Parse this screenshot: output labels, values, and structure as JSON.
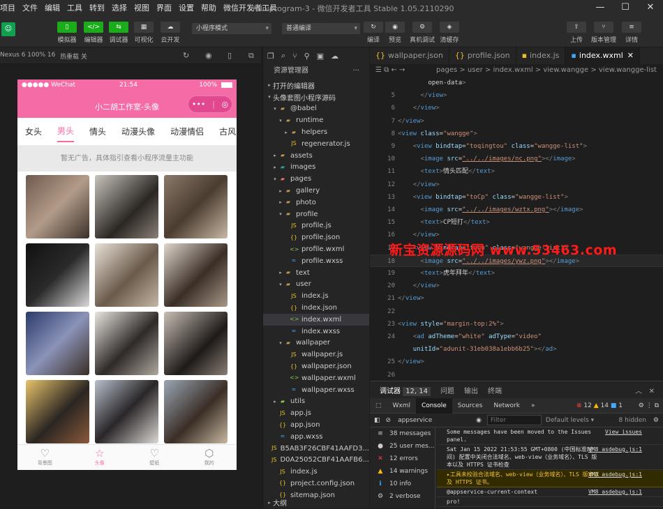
{
  "menu": [
    "项目",
    "文件",
    "编辑",
    "工具",
    "转到",
    "选择",
    "视图",
    "界面",
    "设置",
    "帮助",
    "微信开发者工具"
  ],
  "window_title": "miniprogram-3 - 微信开发者工具 Stable 1.05.2110290",
  "toolbar": {
    "left": [
      "模拟器",
      "编辑器",
      "调试器",
      "可视化",
      "云开发"
    ],
    "mode_select": "小程序模式",
    "compile_select": "普通编译",
    "mid": [
      "编译",
      "预览",
      "真机调试",
      "清缓存"
    ],
    "right": [
      "上传",
      "版本管理",
      "详情"
    ]
  },
  "sim_bar": {
    "device": "Nexus 6 100% 16",
    "hot_reload": "热重载 关"
  },
  "phone": {
    "carrier": "●●●●● WeChat",
    "time": "21:54",
    "battery": "100%",
    "nav_title": "小二胡工作室-头像",
    "capsule_more": "•••",
    "capsule_close": "◎",
    "tabs": [
      "女头",
      "男头",
      "情头",
      "动漫头像",
      "动漫情侣",
      "古风"
    ],
    "ad_text": "暂无广告，具体指引查看小程序流量主功能",
    "tabbar": [
      {
        "icon": "♡",
        "label": "背景图"
      },
      {
        "icon": "☆",
        "label": "头像"
      },
      {
        "icon": "♡",
        "label": "壁纸"
      },
      {
        "icon": "⬡",
        "label": "我的"
      }
    ]
  },
  "explorer": {
    "title": "资源管理器",
    "open_editors": "打开的编辑器",
    "project": "头像套图小程序源码",
    "tree": [
      {
        "name": "@babel",
        "depth": 1,
        "type": "folder",
        "open": true
      },
      {
        "name": "runtime",
        "depth": 2,
        "type": "folder",
        "open": true
      },
      {
        "name": "helpers",
        "depth": 3,
        "type": "folder",
        "open": false
      },
      {
        "name": "regenerator.js",
        "depth": 3,
        "type": "js"
      },
      {
        "name": "assets",
        "depth": 1,
        "type": "folder",
        "open": false
      },
      {
        "name": "images",
        "depth": 1,
        "type": "folder-img",
        "open": false
      },
      {
        "name": "pages",
        "depth": 1,
        "type": "folder-red",
        "open": true
      },
      {
        "name": "gallery",
        "depth": 2,
        "type": "folder",
        "open": false
      },
      {
        "name": "photo",
        "depth": 2,
        "type": "folder",
        "open": false
      },
      {
        "name": "profile",
        "depth": 2,
        "type": "folder",
        "open": true
      },
      {
        "name": "profile.js",
        "depth": 3,
        "type": "js"
      },
      {
        "name": "profile.json",
        "depth": 3,
        "type": "json"
      },
      {
        "name": "profile.wxml",
        "depth": 3,
        "type": "wxml"
      },
      {
        "name": "profile.wxss",
        "depth": 3,
        "type": "wxss"
      },
      {
        "name": "text",
        "depth": 2,
        "type": "folder",
        "open": false
      },
      {
        "name": "user",
        "depth": 2,
        "type": "folder",
        "open": true
      },
      {
        "name": "index.js",
        "depth": 3,
        "type": "js"
      },
      {
        "name": "index.json",
        "depth": 3,
        "type": "json"
      },
      {
        "name": "index.wxml",
        "depth": 3,
        "type": "wxml",
        "selected": true
      },
      {
        "name": "index.wxss",
        "depth": 3,
        "type": "wxss"
      },
      {
        "name": "wallpaper",
        "depth": 2,
        "type": "folder",
        "open": true
      },
      {
        "name": "wallpaper.js",
        "depth": 3,
        "type": "js"
      },
      {
        "name": "wallpaper.json",
        "depth": 3,
        "type": "json"
      },
      {
        "name": "wallpaper.wxml",
        "depth": 3,
        "type": "wxml"
      },
      {
        "name": "wallpaper.wxss",
        "depth": 3,
        "type": "wxss"
      },
      {
        "name": "utils",
        "depth": 1,
        "type": "folder-green",
        "open": false
      },
      {
        "name": "app.js",
        "depth": 1,
        "type": "js"
      },
      {
        "name": "app.json",
        "depth": 1,
        "type": "json"
      },
      {
        "name": "app.wxss",
        "depth": 1,
        "type": "wxss"
      },
      {
        "name": "B5AB3F26CBF41AAFD3...",
        "depth": 1,
        "type": "js"
      },
      {
        "name": "D0A25052CBF41AAFB6...",
        "depth": 1,
        "type": "js"
      },
      {
        "name": "index.js",
        "depth": 1,
        "type": "js"
      },
      {
        "name": "project.config.json",
        "depth": 1,
        "type": "json"
      },
      {
        "name": "sitemap.json",
        "depth": 1,
        "type": "json"
      }
    ],
    "outline": "大纲"
  },
  "editor": {
    "tabs": [
      "wallpaper.json",
      "profile.json",
      "index.js",
      "index.wxml"
    ],
    "breadcrumb": "pages > user > index.wxml > view.wangge > view.wangge-list",
    "lines": [
      {
        "n": "",
        "code": "        open-data>"
      },
      {
        "n": "5",
        "code": "      </view>"
      },
      {
        "n": "6",
        "code": "    </view>"
      },
      {
        "n": "7",
        "code": "</view>"
      },
      {
        "n": "8",
        "code": "<view class=\"wangge\">"
      },
      {
        "n": "9",
        "code": "    <view bindtap=\"toqingtou\" class=\"wangge-list\">"
      },
      {
        "n": "10",
        "code": "      <image src=\"../../images/nc.png\"></image>"
      },
      {
        "n": "11",
        "code": "      <text>情头匹配</text>"
      },
      {
        "n": "12",
        "code": "    </view>"
      },
      {
        "n": "13",
        "code": "    <view bindtap=\"toCp\" class=\"wangge-list\">"
      },
      {
        "n": "14",
        "code": "      <image src=\"../../images/wztx.png\"></image>"
      },
      {
        "n": "15",
        "code": "      <text>CP短打</text>"
      },
      {
        "n": "16",
        "code": "    </view>"
      },
      {
        "n": "17",
        "code": "    <view bindtap=\"tohn\" class=\"wangge-list\">"
      },
      {
        "n": "18",
        "code": "      <image src=\"../../images/ywz.png\"></image>"
      },
      {
        "n": "19",
        "code": "      <text>虎年拜年</text>"
      },
      {
        "n": "20",
        "code": "    </view>"
      },
      {
        "n": "21",
        "code": "</view>"
      },
      {
        "n": "22",
        "code": ""
      },
      {
        "n": "23",
        "code": "<view style=\"margin-top:2%\">"
      },
      {
        "n": "24",
        "code": "    <ad adTheme=\"white\" adType=\"video\""
      },
      {
        "n": "",
        "code": "    unitId=\"adunit-31eb038a1ebb6b25\"></ad>"
      },
      {
        "n": "25",
        "code": "</view>"
      },
      {
        "n": "26",
        "code": ""
      }
    ],
    "current_line": "18",
    "watermark": "新宝资源源码网 www.53463.com"
  },
  "debug": {
    "tabs": [
      "调试器",
      "问题",
      "输出",
      "终端"
    ],
    "position": "12, 14",
    "devtools_tabs": [
      "Wxml",
      "Console",
      "Sources",
      "Network",
      "»"
    ],
    "errors": "12",
    "warnings": "14",
    "info_count": "1",
    "context": "appservice",
    "filter_placeholder": "Filter",
    "levels": "Default levels ▾",
    "hidden": "8 hidden",
    "sidebar": [
      {
        "icon": "≡",
        "label": "38 messages"
      },
      {
        "icon": "●",
        "label": "25 user mes..."
      },
      {
        "icon": "✕",
        "label": "12 errors"
      },
      {
        "icon": "▲",
        "label": "14 warnings"
      },
      {
        "icon": "ℹ",
        "label": "10 info"
      },
      {
        "icon": "⚙",
        "label": "2 verbose"
      }
    ],
    "logs": [
      {
        "text": "Some messages have been moved to the Issues panel.",
        "link": "View issues",
        "kind": "info"
      },
      {
        "text": "Sat Jan 15 2022 21:53:55 GMT+0800 (中国标准时间) 配置中关闭合法域名、web-view（业务域名）、TLS 版本以及 HTTPS 证书检查",
        "link": "VM8_asdebug.js:1",
        "kind": "info"
      },
      {
        "text": "▸工具未校验合法域名、web-view（业务域名）、TLS 版本以及 HTTPS 证书。",
        "link": "VM8_asdebug.js:1",
        "kind": "warn"
      },
      {
        "text": "@appservice-current-context",
        "link": "VM8_asdebug.js:1",
        "kind": "info"
      },
      {
        "text": "pro!",
        "link": "",
        "kind": "info"
      }
    ]
  },
  "colors": {
    "accent": "#f56ba6",
    "green": "#1aad19",
    "watermark": "#ff1a1a"
  }
}
